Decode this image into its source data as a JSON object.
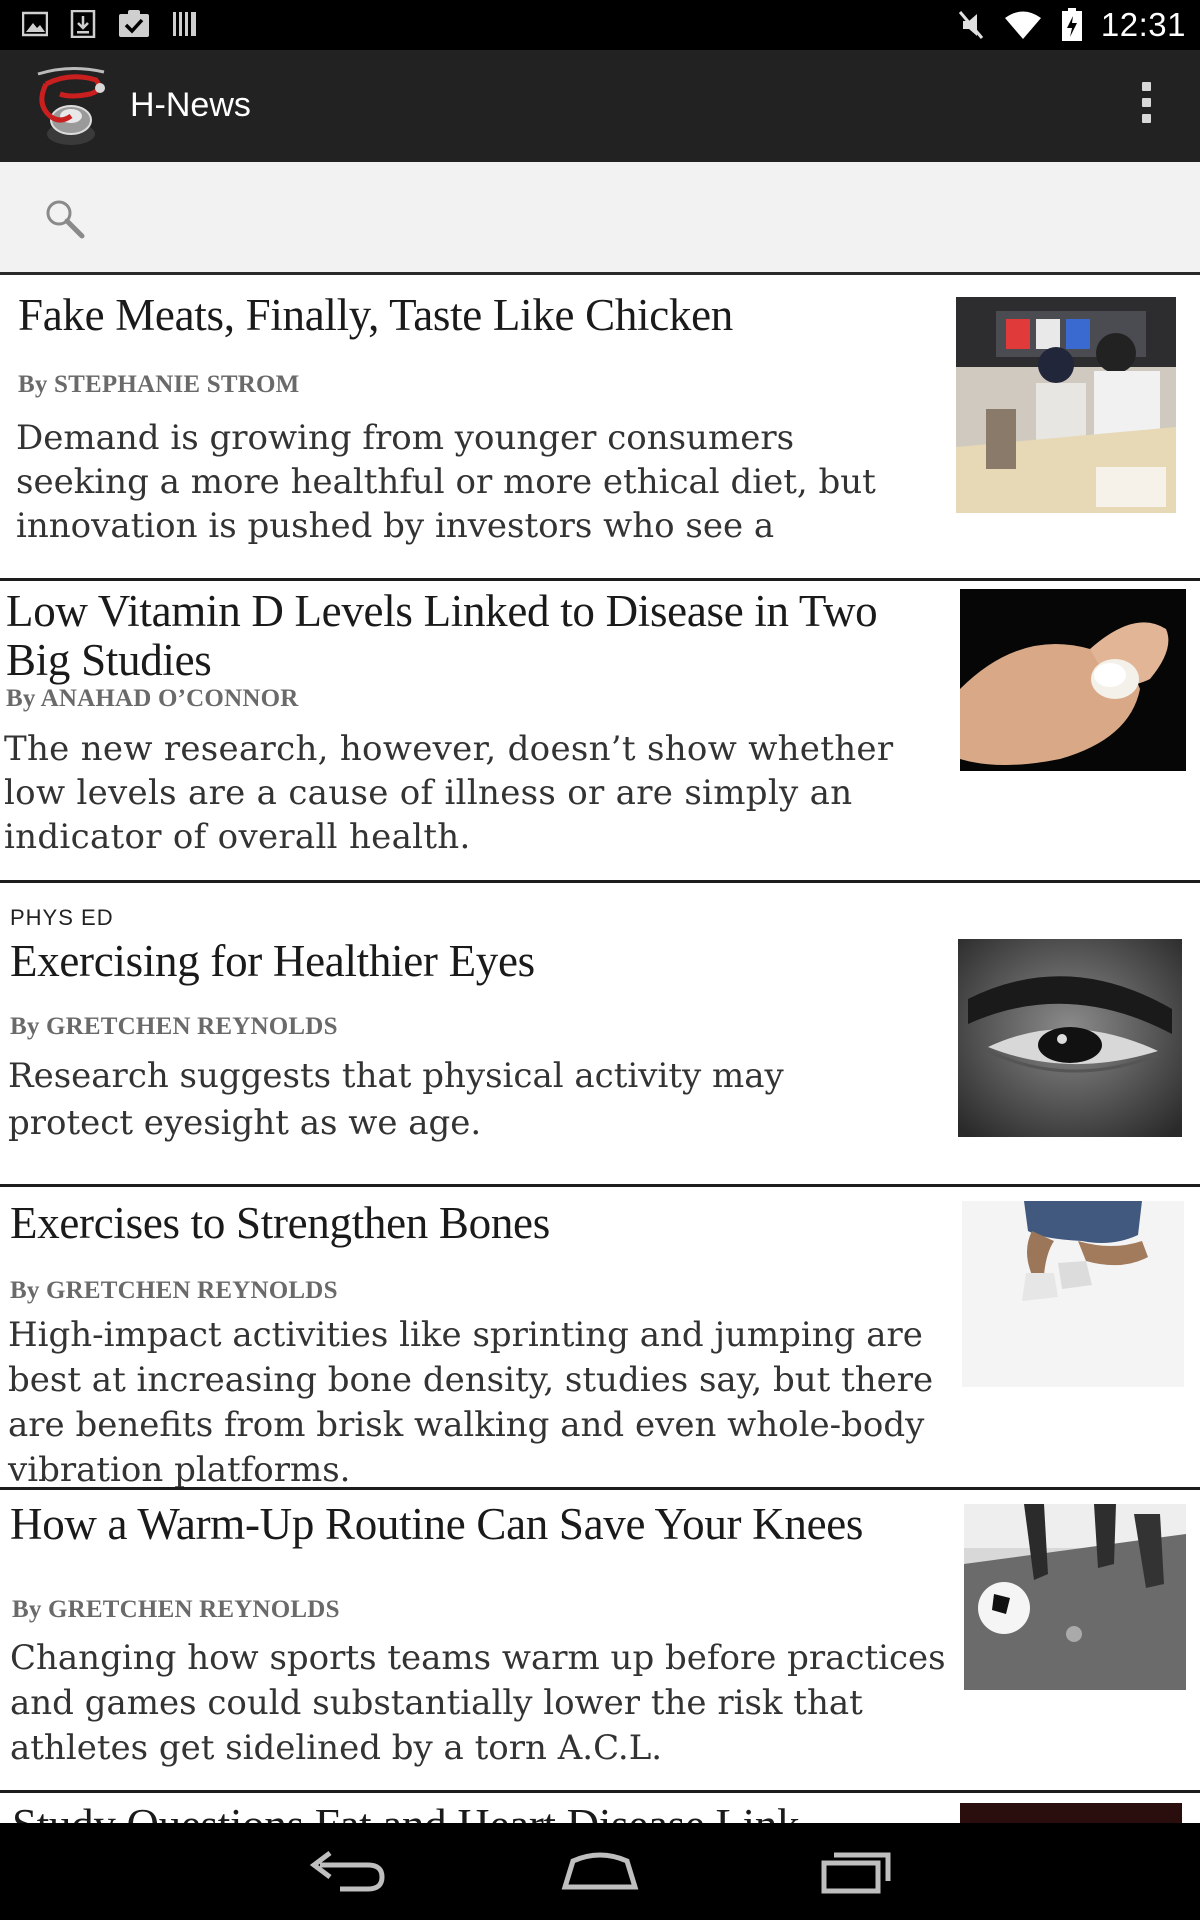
{
  "status_bar": {
    "time": "12:31",
    "left_icons": [
      "image-notification-icon",
      "download-notification-icon",
      "clipboard-check-icon",
      "barcode-icon"
    ],
    "right_icons": [
      "mute-icon",
      "wifi-icon",
      "battery-icon"
    ]
  },
  "app_bar": {
    "title": "H-News",
    "logo_icon": "stethoscope-logo-icon",
    "menu_icon": "overflow-menu-icon"
  },
  "search": {
    "value": "",
    "placeholder": ""
  },
  "articles": [
    {
      "kicker": "",
      "title": "Fake Meats, Finally, Taste Like Chicken",
      "byline": "By STEPHANIE STROM",
      "summary": "Demand is growing from younger consumers seeking a more healthful or more ethical diet, but innovation is pushed by investors who see a"
    },
    {
      "kicker": "",
      "title": "Low Vitamin D Levels Linked to Disease in Two Big Studies",
      "byline": "By ANAHAD O’CONNOR",
      "summary": "The new research, however, doesn’t show whether low levels are a cause of illness or are simply an indicator of overall health."
    },
    {
      "kicker": "PHYS ED",
      "title": "Exercising for Healthier Eyes",
      "byline": "By GRETCHEN REYNOLDS",
      "summary": "Research suggests that physical activity may protect eyesight as we age."
    },
    {
      "kicker": "",
      "title": "Exercises to Strengthen Bones",
      "byline": "By GRETCHEN REYNOLDS",
      "summary": "High-impact activities like sprinting and jumping are best at increasing bone density, studies say, but there are benefits from brisk walking and even whole-body vibration platforms."
    },
    {
      "kicker": "",
      "title": "How a Warm-Up Routine Can Save Your Knees",
      "byline": "By GRETCHEN REYNOLDS",
      "summary": "Changing how sports teams warm up before practices and games could substantially lower the risk that athletes get sidelined by a torn A.C.L."
    },
    {
      "kicker": "",
      "title": "Study Questions Fat and Heart Disease Link",
      "byline": "",
      "summary": ""
    }
  ],
  "nav_bar": {
    "icons": [
      "back-icon",
      "home-icon",
      "recent-apps-icon"
    ]
  }
}
